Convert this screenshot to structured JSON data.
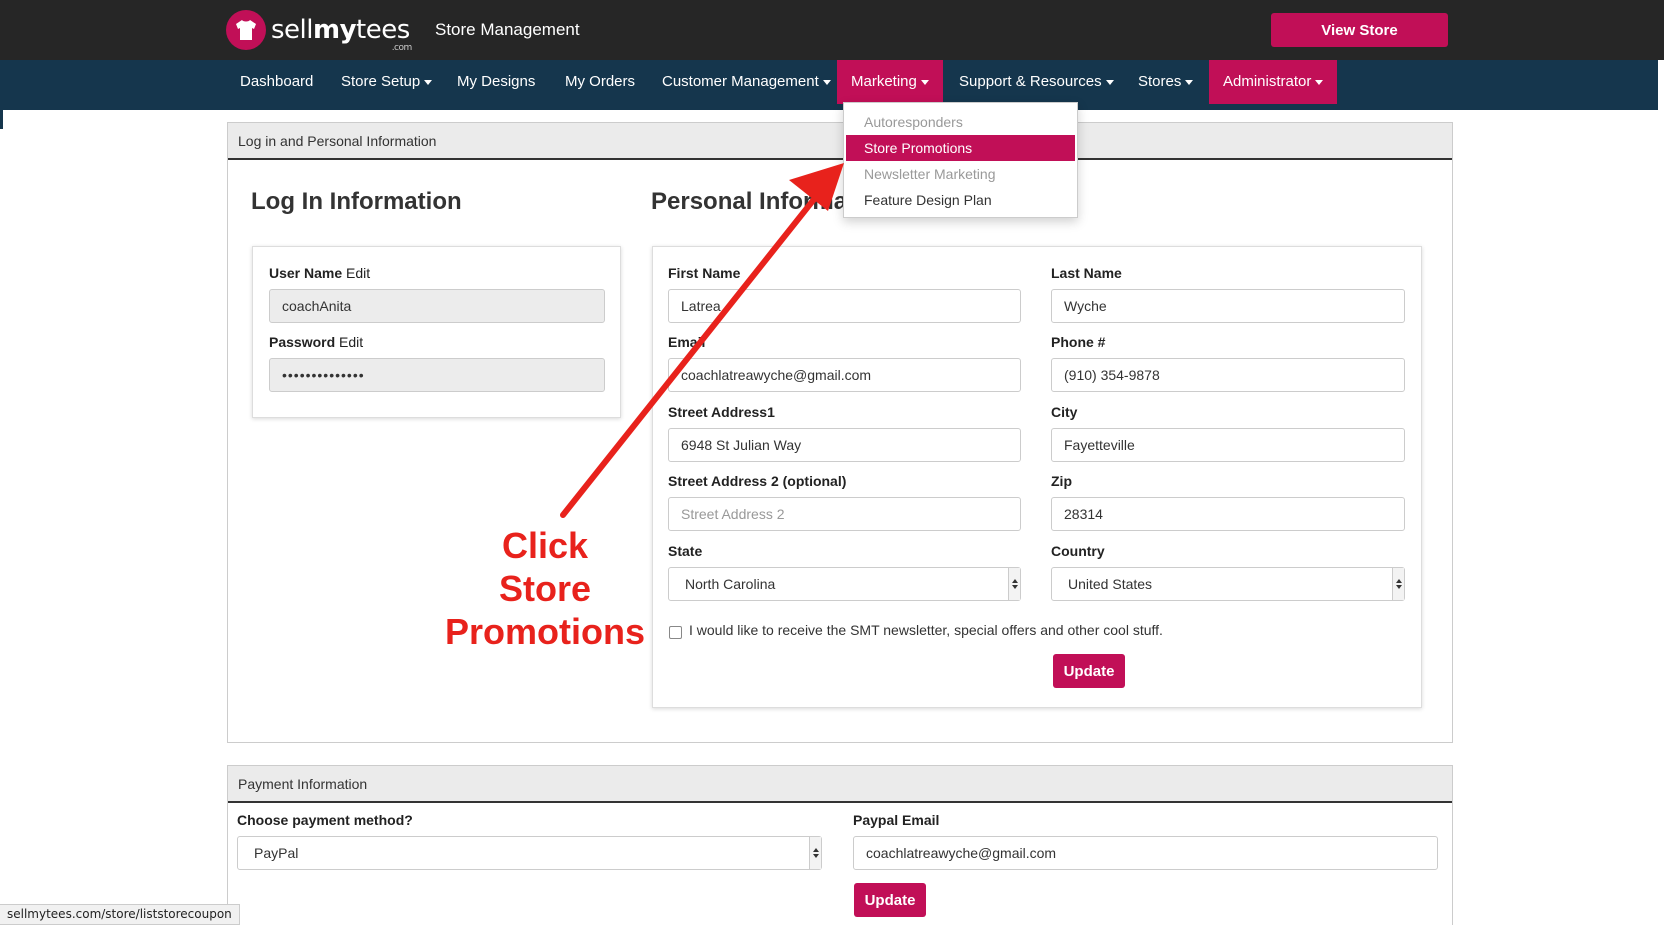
{
  "header": {
    "logo_text_light": "sell",
    "logo_text_bold": "my",
    "logo_text_end": "tees",
    "logo_com": ".com",
    "title": "Store Management",
    "view_store_label": "View Store"
  },
  "nav": {
    "items": [
      {
        "label": "Dashboard"
      },
      {
        "label": "Store Setup"
      },
      {
        "label": "My Designs"
      },
      {
        "label": "My Orders"
      },
      {
        "label": "Customer Management"
      },
      {
        "label": "Marketing"
      },
      {
        "label": "Support & Resources"
      },
      {
        "label": "Stores"
      },
      {
        "label": "Administrator"
      }
    ],
    "marketing_menu": [
      {
        "label": "Autoresponders",
        "state": "disabled"
      },
      {
        "label": "Store Promotions",
        "state": "active"
      },
      {
        "label": "Newsletter Marketing",
        "state": "disabled"
      },
      {
        "label": "Feature Design Plan",
        "state": "normal"
      }
    ]
  },
  "login_panel": {
    "header": "Log in and Personal Information",
    "login_title": "Log In Information",
    "personal_title": "Personal Information",
    "username_label": "User Name",
    "username_edit": "Edit",
    "username_value": "coachAnita",
    "password_label": "Password",
    "password_edit": "Edit",
    "password_value": "••••••••••••••"
  },
  "personal": {
    "first_name_label": "First Name",
    "first_name_value": "Latrea",
    "last_name_label": "Last Name",
    "last_name_value": "Wyche",
    "email_label": "Email",
    "email_value": "coachlatreawyche@gmail.com",
    "phone_label": "Phone #",
    "phone_value": "(910) 354-9878",
    "street1_label": "Street Address1",
    "street1_value": "6948 St Julian Way",
    "city_label": "City",
    "city_value": "Fayetteville",
    "street2_label": "Street Address 2 (optional)",
    "street2_placeholder": "Street Address 2",
    "zip_label": "Zip",
    "zip_value": "28314",
    "state_label": "State",
    "state_value": "North Carolina",
    "country_label": "Country",
    "country_value": "United States",
    "newsletter_label": "I would like to receive the SMT newsletter, special offers and other cool stuff.",
    "newsletter_checked": false,
    "update_label": "Update"
  },
  "payment": {
    "header": "Payment Information",
    "method_label": "Choose payment method?",
    "method_value": "PayPal",
    "paypal_label": "Paypal Email",
    "paypal_value": "coachlatreawyche@gmail.com",
    "update_label": "Update"
  },
  "annotation": {
    "line1": "Click",
    "line2": "Store",
    "line3": "Promotions",
    "color": "#e8221c"
  },
  "status_bar": {
    "url": "sellmytees.com/store/liststorecoupon"
  },
  "colors": {
    "brand": "#c10f57",
    "nav_bg": "#15364d",
    "top_bg": "#262626"
  }
}
